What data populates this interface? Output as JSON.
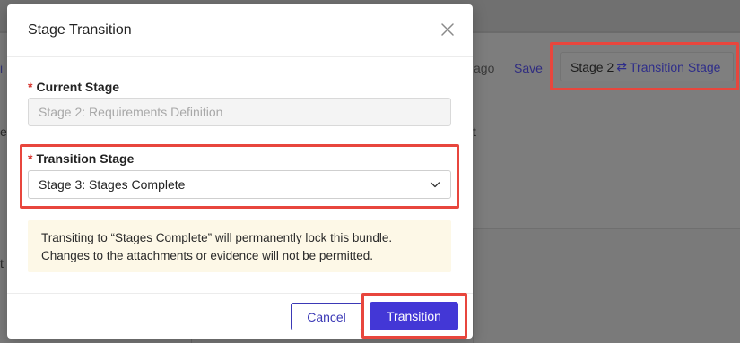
{
  "background": {
    "left_fragments": [
      "i",
      "e",
      "t"
    ],
    "ago_text": "ago",
    "save_label": "Save",
    "t_fragment": "t",
    "stage_badge": {
      "current": "Stage 2",
      "swap_glyph": "⇄",
      "link_label": "Transition Stage"
    }
  },
  "modal": {
    "title": "Stage Transition",
    "close_icon": "close-icon",
    "current_stage": {
      "required_mark": "*",
      "label": "Current Stage",
      "value": "Stage 2: Requirements Definition"
    },
    "transition_stage": {
      "required_mark": "*",
      "label": "Transition Stage",
      "selected": "Stage 3: Stages Complete",
      "icon": "chevron-down-icon"
    },
    "warning": {
      "line1": "Transiting to “Stages Complete” will permanently lock this bundle.",
      "line2": "Changes to the attachments or evidence will not be permitted."
    },
    "cancel_label": "Cancel",
    "transition_label": "Transition"
  },
  "colors": {
    "accent": "#4337d6",
    "highlight": "#e8463d",
    "warning_bg": "#fdf8e7",
    "required": "#d6312b"
  }
}
